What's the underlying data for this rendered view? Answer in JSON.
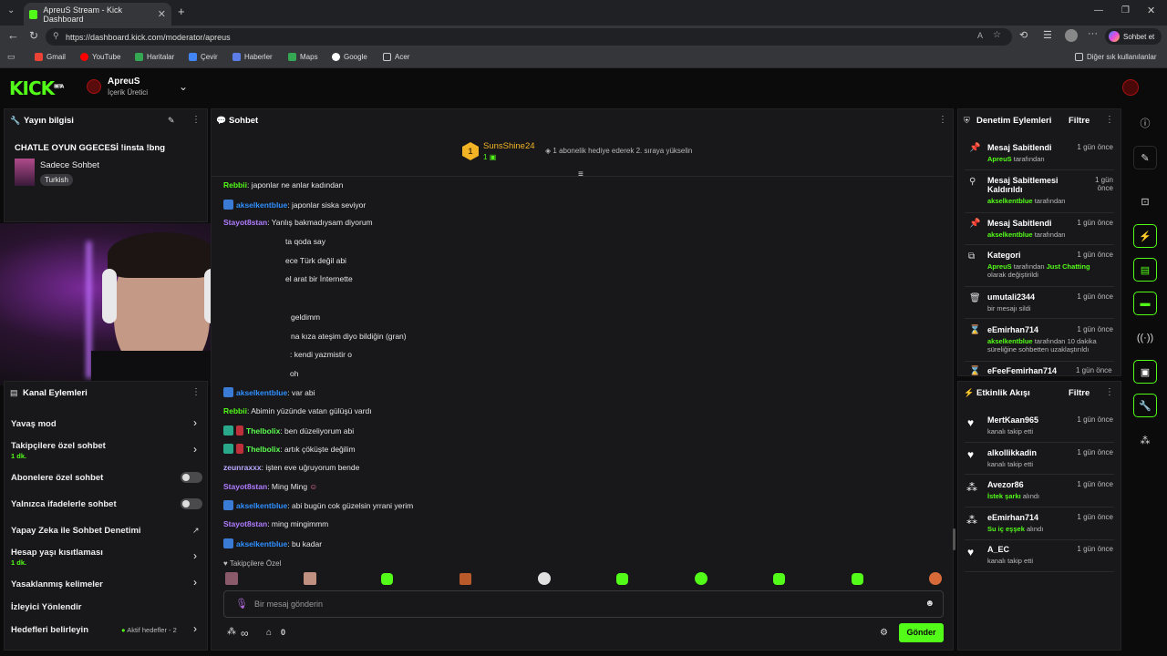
{
  "browser": {
    "tab_title": "ApreuS Stream - Kick Dashboard",
    "url": "https://dashboard.kick.com/moderator/apreus",
    "copilot_label": "Sohbet et",
    "bookmarks": [
      "Gmail",
      "YouTube",
      "Haritalar",
      "Çevir",
      "Haberler",
      "Maps",
      "Google",
      "Acer"
    ],
    "other_bookmarks": "Diğer sık kullanılanlar"
  },
  "header": {
    "logo": "KICK",
    "beta": "BETA",
    "channel_name": "ApreuS",
    "channel_role": "İçerik Üretici"
  },
  "stream_info": {
    "title": "Yayın bilgisi",
    "stream_title": "CHATLE OYUN GGECESİ !insta !bng",
    "category": "Sadece Sohbet",
    "tag": "Turkish"
  },
  "channel_actions": {
    "title": "Kanal Eylemleri",
    "items": [
      {
        "label": "Yavaş mod",
        "sub": ""
      },
      {
        "label": "Takipçilere özel sohbet",
        "sub": "1 dk."
      },
      {
        "label": "Abonelere özel sohbet",
        "sub": ""
      },
      {
        "label": "Yalnızca ifadelerle sohbet",
        "sub": ""
      },
      {
        "label": "Yapay Zeka ile Sohbet Denetimi",
        "sub": ""
      },
      {
        "label": "Hesap yaşı kısıtlaması",
        "sub": "1 dk."
      },
      {
        "label": "Yasaklanmış kelimeler",
        "sub": ""
      },
      {
        "label": "İzleyici Yönlendir",
        "sub": ""
      },
      {
        "label": "Hedefleri belirleyin",
        "sub": "Aktif hedefler - 2"
      }
    ]
  },
  "chat": {
    "title": "Sohbet",
    "pinned_user": "SunsShine24",
    "pinned_count": "1",
    "pinned_rank": "1",
    "pinned_text": "1 abonelik hediye ederek 2. sıraya yükselin",
    "messages": [
      {
        "user": "Rebbii",
        "text": "japonlar ne anlar kadından"
      },
      {
        "user": "akselkentblue",
        "text": "japonlar siska seviyor"
      },
      {
        "user": "Stayot8stan",
        "text": "Yanlış bakmadıysam diyorum"
      },
      {
        "user": "",
        "text": "ta qoda say"
      },
      {
        "user": "",
        "text": "ece Türk değil abi"
      },
      {
        "user": "",
        "text": "el arat bir İnternette"
      },
      {
        "user": "",
        "text": "geldimm"
      },
      {
        "user": "",
        "text": "na kıza ateşim diyo bildiğin (gran)"
      },
      {
        "user": "",
        "text": ": kendi yazmistir o"
      },
      {
        "user": "",
        "text": "oh"
      },
      {
        "user": "akselkentblue",
        "text": "var abi"
      },
      {
        "user": "Rebbii",
        "text": "Abimin yüzünde vatan gülüşü vardı"
      },
      {
        "user": "Thelbolix",
        "text": "ben düzeliyorum abi"
      },
      {
        "user": "Thelbolix",
        "text": "artık çöküşte değilim"
      },
      {
        "user": "zeunraxxx",
        "text": "işten eve uğruyorum bende"
      },
      {
        "user": "Stayot8stan",
        "text": "Ming Ming"
      },
      {
        "user": "akselkentblue",
        "text": "abi bugün cok güzelsin yrrani yerim"
      },
      {
        "user": "Stayot8stan",
        "text": "ming mingimmm"
      },
      {
        "user": "akselkentblue",
        "text": "bu kadar"
      }
    ],
    "followers_only": "Takipçilere Özel",
    "input_placeholder": "Bir mesaj gönderin",
    "points": "∞",
    "store_count": "0",
    "send_label": "Gönder"
  },
  "mod_actions": {
    "title": "Denetim Eylemleri",
    "filter": "Filtre",
    "items": [
      {
        "title": "Mesaj Sabitlendi",
        "time": "1 gün önce",
        "actor": "ApreuS",
        "suffix": "tarafından"
      },
      {
        "title": "Mesaj Sabitlemesi Kaldırıldı",
        "time": "1 gün önce",
        "actor": "akselkentblue",
        "suffix": "tarafından"
      },
      {
        "title": "Mesaj Sabitlendi",
        "time": "1 gün önce",
        "actor": "akselkentblue",
        "suffix": "tarafından"
      },
      {
        "title": "Kategori",
        "time": "1 gün önce",
        "actor": "ApreuS",
        "suffix": "tarafından",
        "extra": "Just Chatting",
        "extra2": "olarak değiştirildi"
      },
      {
        "title": "umutali2344",
        "time": "1 gün önce",
        "actor": "",
        "suffix": "bir mesajı sildi"
      },
      {
        "title": "eEmirhan714",
        "time": "1 gün önce",
        "actor": "akselkentblue",
        "suffix": "tarafından 10 dakika süreliğine sohbetten uzaklaştırıldı"
      },
      {
        "title": "eFeeFemirhan714",
        "time": "1 gün önce",
        "actor": "",
        "suffix": ""
      }
    ]
  },
  "activity": {
    "title": "Etkinlik Akışı",
    "filter": "Filtre",
    "items": [
      {
        "user": "MertKaan965",
        "time": "1 gün önce",
        "desc": "kanalı takip etti",
        "hl": ""
      },
      {
        "user": "alkollikkadin",
        "time": "1 gün önce",
        "desc": "kanalı takip etti",
        "hl": ""
      },
      {
        "user": "Avezor86",
        "time": "1 gün önce",
        "desc": "alındı",
        "hl": "İstek şarkı"
      },
      {
        "user": "eEmirhan714",
        "time": "1 gün önce",
        "desc": "alındı",
        "hl": "Su iç eşşek"
      },
      {
        "user": "A_EC",
        "time": "1 gün önce",
        "desc": "kanalı takip etti",
        "hl": ""
      }
    ]
  },
  "colors": {
    "accent": "#53fc18",
    "panel": "#18181b",
    "bg": "#0b0b0c"
  }
}
